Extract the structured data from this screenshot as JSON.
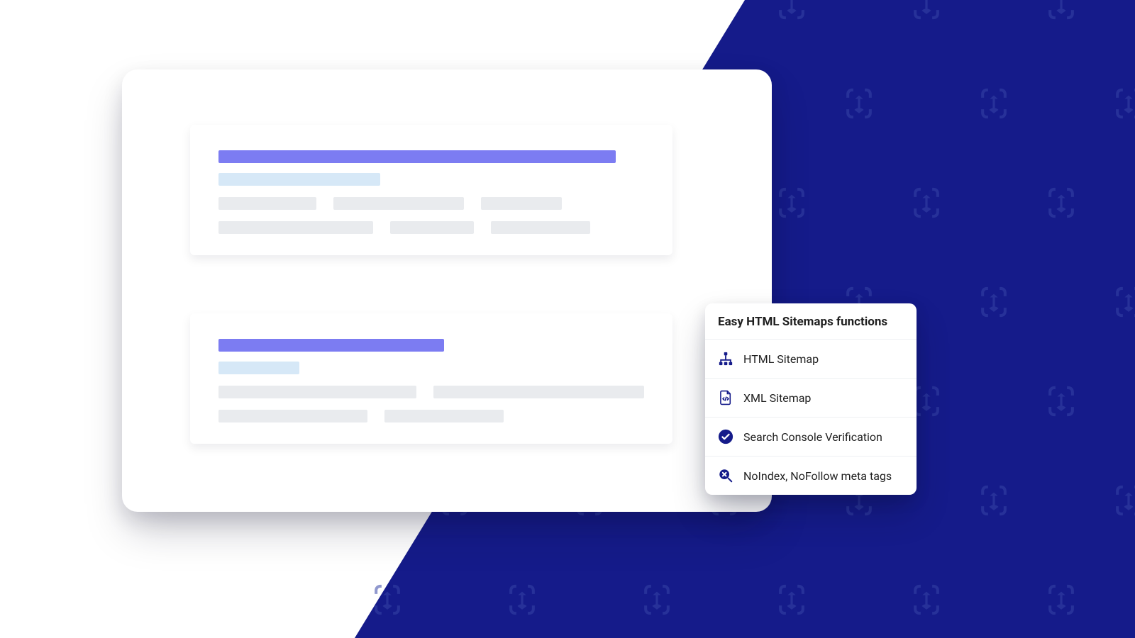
{
  "popover": {
    "title": "Easy HTML Sitemaps functions",
    "items": [
      {
        "icon": "sitemap-icon",
        "label": "HTML Sitemap"
      },
      {
        "icon": "file-code-icon",
        "label": "XML Sitemap"
      },
      {
        "icon": "check-circle-icon",
        "label": "Search Console Verification"
      },
      {
        "icon": "search-x-icon",
        "label": "NoIndex, NoFollow meta tags"
      }
    ]
  },
  "brand": {
    "accent": "#151b8a",
    "bar_primary": "#7c7cf2",
    "bar_subtitle": "#d6e8f7",
    "bar_grey": "#e9ebee"
  }
}
